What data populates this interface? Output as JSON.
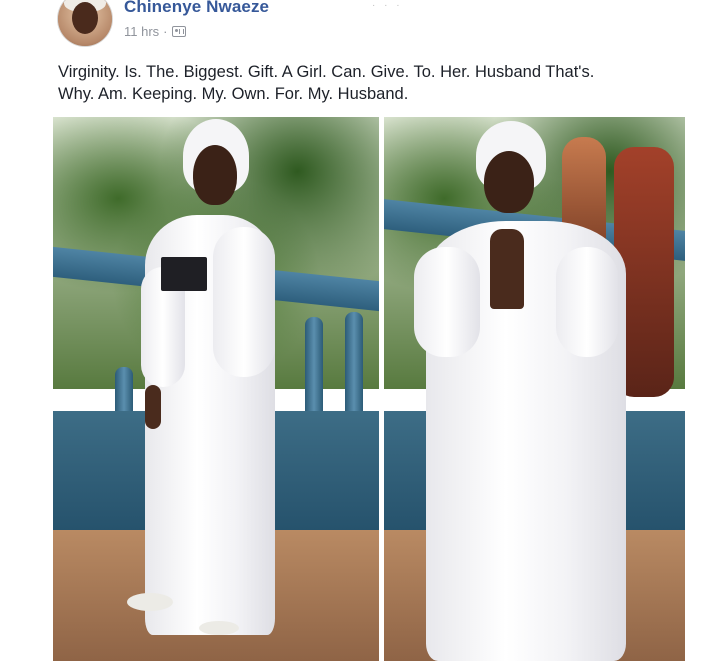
{
  "post": {
    "author_name": "Chinenye Nwaeze",
    "timestamp": "11 hrs",
    "separator": "·",
    "audience_icon": "friends-audience-icon",
    "text_lines": [
      "Virginity. Is. The. Biggest. Gift. A Girl. Can. Give. To. Her. Husband That's.",
      "Why. Am. Keeping. My. Own. For. My. Husband."
    ],
    "more_icon": "dots-icon"
  },
  "colors": {
    "name_link": "#365899",
    "meta_gray": "#90949c",
    "body_text": "#1d2129"
  }
}
